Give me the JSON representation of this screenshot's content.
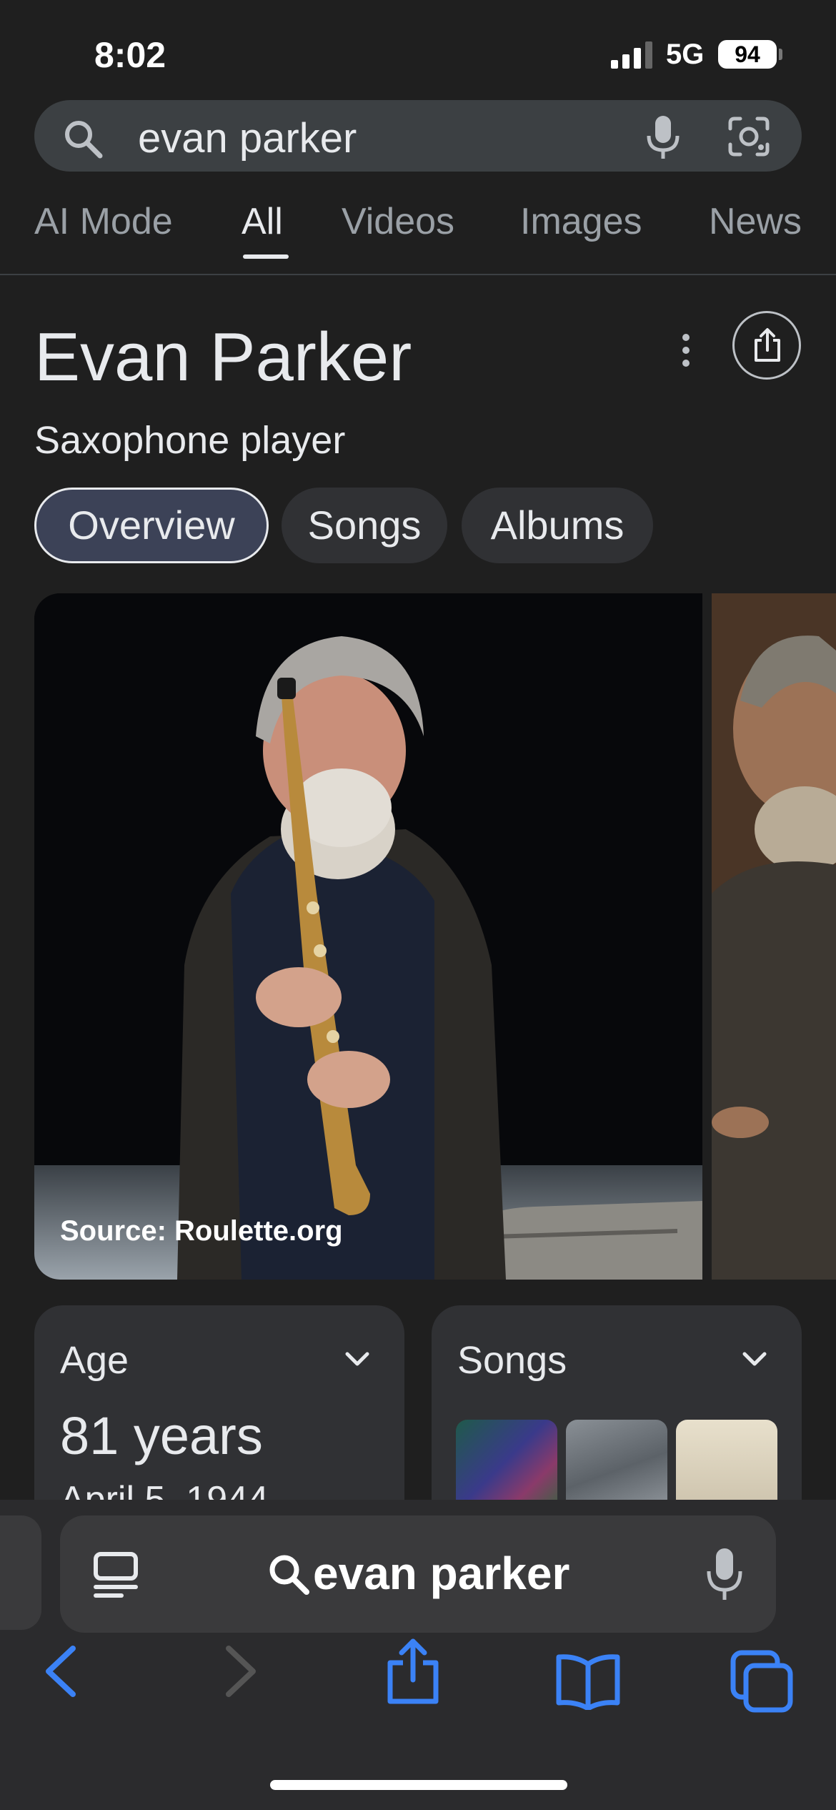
{
  "status": {
    "time": "8:02",
    "network": "5G",
    "battery": "94"
  },
  "search": {
    "query": "evan parker"
  },
  "tabs": [
    {
      "label": "AI Mode"
    },
    {
      "label": "All"
    },
    {
      "label": "Videos"
    },
    {
      "label": "Images"
    },
    {
      "label": "News"
    }
  ],
  "panel": {
    "title": "Evan Parker",
    "subtitle": "Saxophone player",
    "chips": [
      {
        "label": "Overview"
      },
      {
        "label": "Songs"
      },
      {
        "label": "Albums"
      }
    ],
    "image_source": "Source: Roulette.org"
  },
  "cards": {
    "age": {
      "title": "Age",
      "value": "81 years",
      "date": "April 5, 1944"
    },
    "songs": {
      "title": "Songs"
    }
  },
  "browser": {
    "address_text": "evan parker"
  },
  "colors": {
    "accent_blue": "#3b82f6",
    "background": "#1f1f1f",
    "card": "#303134"
  }
}
